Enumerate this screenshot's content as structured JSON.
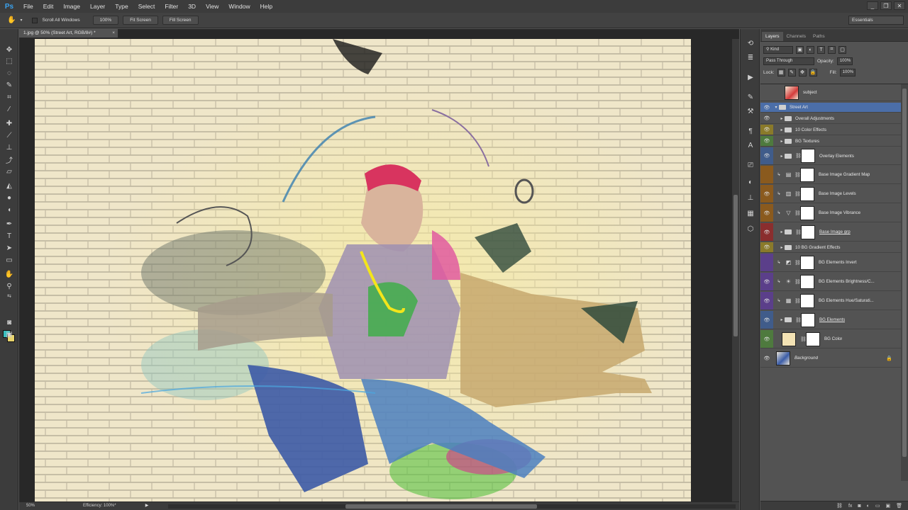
{
  "app": {
    "logo": "Ps"
  },
  "menu": [
    "File",
    "Edit",
    "Image",
    "Layer",
    "Type",
    "Select",
    "Filter",
    "3D",
    "View",
    "Window",
    "Help"
  ],
  "window_controls": {
    "minimize": "_",
    "restore": "❐",
    "close": "✕"
  },
  "options_bar": {
    "scroll_all_windows": "Scroll All Windows",
    "zoom_100": "100%",
    "fit_screen": "Fit Screen",
    "fill_screen": "Fill Screen"
  },
  "workspace": "Essentials",
  "document": {
    "tab_title": "1.jpg @ 50% (Street Art, RGB/8#) *",
    "tab_close": "×"
  },
  "status": {
    "zoom": "50%",
    "efficiency": "Efficiency: 100%*",
    "arrow": "▶"
  },
  "colors": {
    "foreground": "#3bbfbf",
    "background": "#e8d36b",
    "selected_layer": "#4b6ea8"
  },
  "layers_panel": {
    "tabs": [
      "Layers",
      "Channels",
      "Paths"
    ],
    "kind": "Kind",
    "blend_mode": "Pass Through",
    "opacity_label": "Opacity:",
    "opacity_value": "100%",
    "lock_label": "Lock:",
    "fill_label": "Fill:",
    "fill_value": "100%",
    "layers": [
      {
        "name": "subject"
      },
      {
        "name": "Street Art"
      },
      {
        "name": "Overall Adjustments"
      },
      {
        "name": "10 Color Effects"
      },
      {
        "name": "BG Textures"
      },
      {
        "name": "Overlay Elements"
      },
      {
        "name": "Base Image Gradient Map"
      },
      {
        "name": "Base Image Levels"
      },
      {
        "name": "Base Image Vibrance"
      },
      {
        "name": "Base Image grp"
      },
      {
        "name": "10 BG Gradient Effects"
      },
      {
        "name": "BG Elements Invert"
      },
      {
        "name": "BG Elements Brightness/C..."
      },
      {
        "name": "BG Elements Hue/Saturati..."
      },
      {
        "name": "BG Elements"
      },
      {
        "name": "BG Color"
      },
      {
        "name": "Background"
      }
    ],
    "footer_icons": [
      "⛓",
      "fx",
      "◙",
      "◐",
      "▭",
      "▣",
      "🗑"
    ]
  }
}
